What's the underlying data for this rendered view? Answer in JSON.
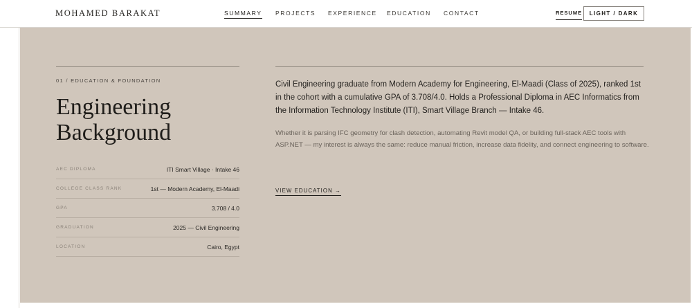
{
  "nav": {
    "brand": "MOHAMED BARAKAT",
    "links": [
      {
        "label": "SUMMARY"
      },
      {
        "label": "PROJECTS"
      },
      {
        "label": "EXPERIENCE"
      },
      {
        "label": "EDUCATION"
      },
      {
        "label": "CONTACT"
      }
    ],
    "active_link": "SUMMARY",
    "resume_label": "RESUME",
    "theme_toggle_label": "LIGHT / DARK"
  },
  "section": {
    "eyebrow": "01 / EDUCATION & FOUNDATION",
    "title_line1": "Engineering",
    "title_line2": "Background",
    "facts": [
      {
        "label": "AEC DIPLOMA",
        "value": "ITI Smart Village · Intake 46"
      },
      {
        "label": "COLLEGE CLASS RANK",
        "value": "1st — Modern Academy, El-Maadi"
      },
      {
        "label": "GPA",
        "value": "3.708 / 4.0"
      },
      {
        "label": "GRADUATION",
        "value": "2025 — Civil Engineering"
      },
      {
        "label": "LOCATION",
        "value": "Cairo, Egypt"
      }
    ],
    "lead": "Civil Engineering graduate from Modern Academy for Engineering, El-Maadi (Class of 2025), ranked 1st in the cohort with a cumulative GPA of 3.708/4.0. Holds a Professional Diploma in AEC Informatics from the Information Technology Institute (ITI), Smart Village Branch — Intake 46.",
    "body": "Whether it is parsing IFC geometry for clash detection, automating Revit model QA, or building full-stack AEC tools with ASP.NET — my interest is always the same: reduce manual friction, increase data fidelity, and connect engineering to software.",
    "cta_label": "VIEW EDUCATION →"
  },
  "colors": {
    "section_background": "#d0c6bb",
    "text_primary": "#1f1d1a",
    "text_muted": "#6a635b",
    "rule": "#8f877e"
  }
}
